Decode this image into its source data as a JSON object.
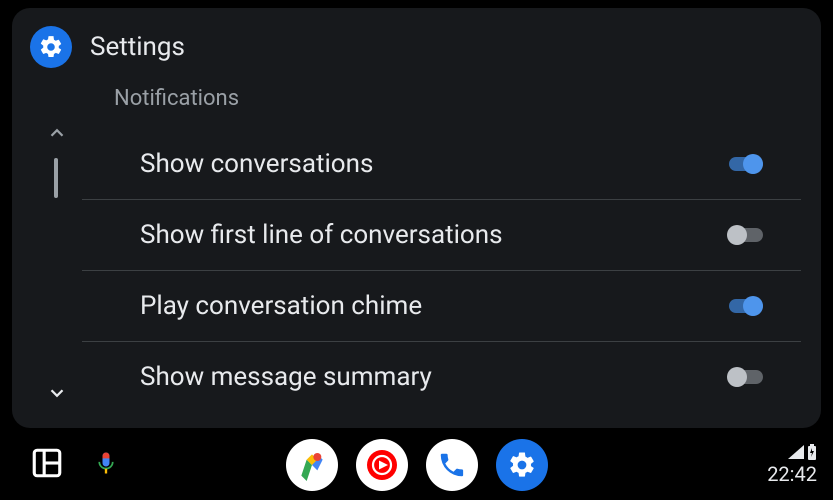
{
  "header": {
    "title": "Settings"
  },
  "section": {
    "title": "Notifications"
  },
  "rows": [
    {
      "label": "Show conversations",
      "on": true
    },
    {
      "label": "Show first line of conversations",
      "on": false
    },
    {
      "label": "Play conversation chime",
      "on": true
    },
    {
      "label": "Show message summary",
      "on": false
    }
  ],
  "status": {
    "time": "22:42"
  },
  "colors": {
    "accent": "#1a73e8",
    "toggle_on": "#4e95ec",
    "toggle_off": "#bdc1c6"
  }
}
